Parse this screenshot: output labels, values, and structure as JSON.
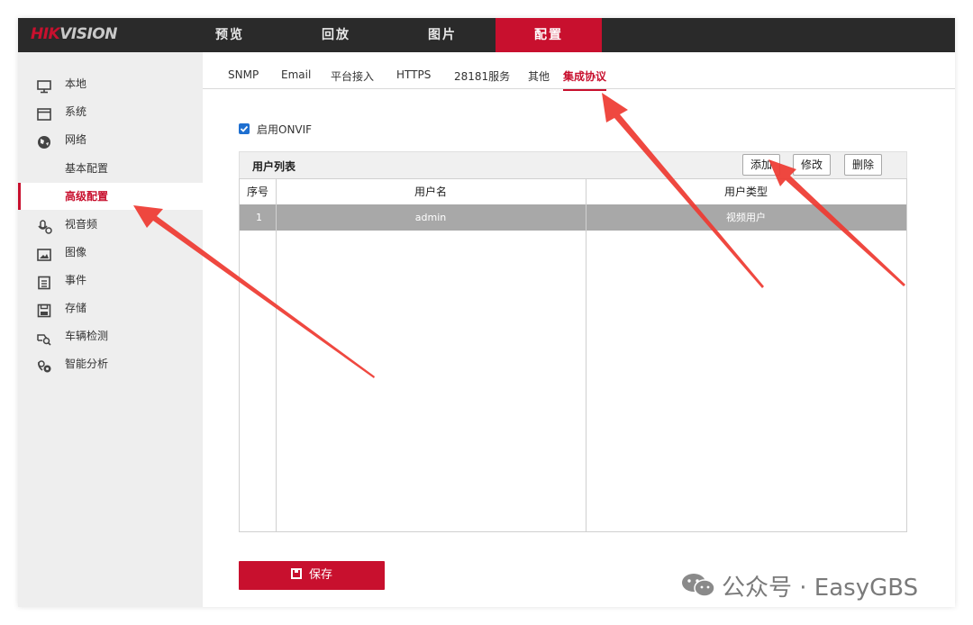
{
  "brand": {
    "logo_red": "HIK",
    "logo_gray": "VISION",
    "accent_color": "#c8102e"
  },
  "top_nav": [
    {
      "label": "预览",
      "active": false
    },
    {
      "label": "回放",
      "active": false
    },
    {
      "label": "图片",
      "active": false
    },
    {
      "label": "配置",
      "active": true
    }
  ],
  "sidebar": {
    "items": [
      {
        "label": "本地",
        "icon": "monitor-icon"
      },
      {
        "label": "系统",
        "icon": "system-window-icon"
      },
      {
        "label": "网络",
        "icon": "globe-icon"
      },
      {
        "label": "基本配置",
        "icon": ""
      },
      {
        "label": "高级配置",
        "icon": "",
        "active": true
      },
      {
        "label": "视音频",
        "icon": "microphone-icon"
      },
      {
        "label": "图像",
        "icon": "image-icon"
      },
      {
        "label": "事件",
        "icon": "event-list-icon"
      },
      {
        "label": "存储",
        "icon": "storage-icon"
      },
      {
        "label": "车辆检测",
        "icon": "vehicle-detect-icon"
      },
      {
        "label": "智能分析",
        "icon": "smart-analysis-icon"
      }
    ]
  },
  "tabs": [
    {
      "label": "SNMP"
    },
    {
      "label": "Email"
    },
    {
      "label": "平台接入"
    },
    {
      "label": "HTTPS"
    },
    {
      "label": "28181服务"
    },
    {
      "label": "其他"
    },
    {
      "label": "集成协议",
      "active": true
    }
  ],
  "onvif": {
    "checked": true,
    "label": "启用ONVIF"
  },
  "user_list": {
    "title": "用户列表",
    "add_label": "添加",
    "edit_label": "修改",
    "delete_label": "删除",
    "columns": [
      "序号",
      "用户名",
      "用户类型"
    ],
    "rows": [
      {
        "index": "1",
        "username": "admin",
        "type": "视频用户",
        "selected": true
      }
    ]
  },
  "save_label": "保存",
  "watermark": {
    "text": "公众号 · EasyGBS",
    "icon": "wechat-icon"
  }
}
